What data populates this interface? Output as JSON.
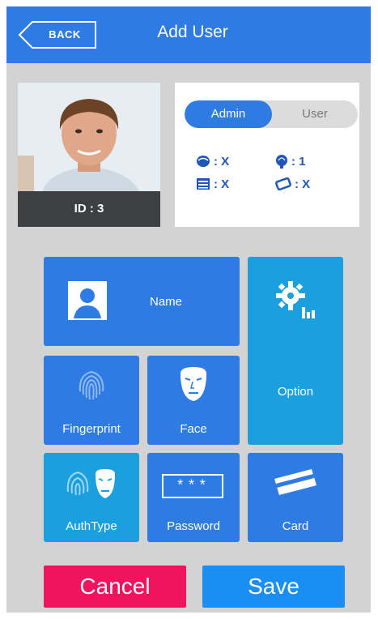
{
  "header": {
    "back_label": "BACK",
    "title": "Add User"
  },
  "profile": {
    "id_label": "ID : 3"
  },
  "role_toggle": {
    "options": [
      "Admin",
      "User"
    ],
    "selected": "Admin"
  },
  "stats": {
    "face": ": X",
    "fingerprint": ": 1",
    "password": ": X",
    "card": ": X"
  },
  "tiles": {
    "name": "Name",
    "option": "Option",
    "fingerprint": "Fingerprint",
    "face": "Face",
    "authtype": "AuthType",
    "password": "Password",
    "password_mask": "***",
    "card": "Card"
  },
  "actions": {
    "cancel": "Cancel",
    "save": "Save"
  },
  "colors": {
    "primary": "#2e7be3",
    "secondary": "#1aa0de",
    "cancel": "#f0135e",
    "save": "#1a8ef2",
    "background": "#d3d3d3"
  },
  "icons": [
    "back-arrow-icon",
    "face-icon",
    "fingerprint-icon",
    "password-icon",
    "card-icon",
    "user-icon",
    "gear-icon",
    "mask-icon"
  ]
}
